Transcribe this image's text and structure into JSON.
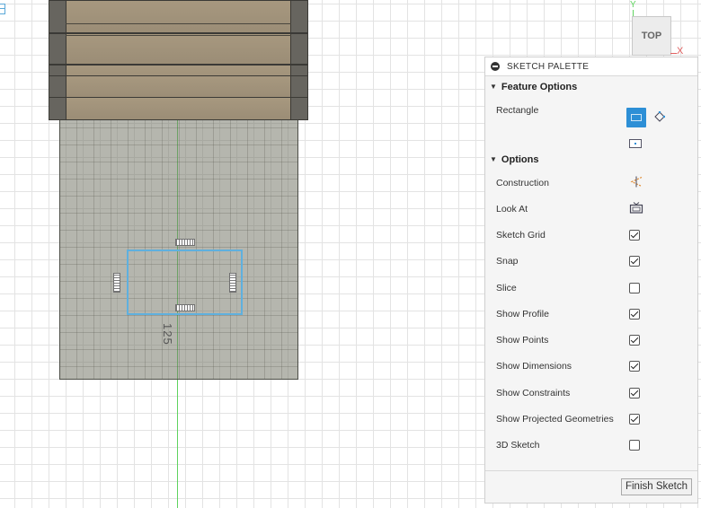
{
  "viewcube": {
    "face_label": "TOP",
    "y_axis_label": "Y",
    "x_axis_label": "X"
  },
  "sketch": {
    "dimension_value": "125"
  },
  "palette": {
    "title": "SKETCH PALETTE",
    "feature_options_label": "Feature Options",
    "rectangle_label": "Rectangle",
    "options_label": "Options",
    "options": [
      {
        "label": "Construction",
        "control": "construction-icon"
      },
      {
        "label": "Look At",
        "control": "look-at-icon"
      },
      {
        "label": "Sketch Grid",
        "control": "checkbox",
        "checked": true
      },
      {
        "label": "Snap",
        "control": "checkbox",
        "checked": true
      },
      {
        "label": "Slice",
        "control": "checkbox",
        "checked": false
      },
      {
        "label": "Show Profile",
        "control": "checkbox",
        "checked": true
      },
      {
        "label": "Show Points",
        "control": "checkbox",
        "checked": true
      },
      {
        "label": "Show Dimensions",
        "control": "checkbox",
        "checked": true
      },
      {
        "label": "Show Constraints",
        "control": "checkbox",
        "checked": true
      },
      {
        "label": "Show Projected Geometries",
        "control": "checkbox",
        "checked": true
      },
      {
        "label": "3D Sketch",
        "control": "checkbox",
        "checked": false
      }
    ],
    "finish_label": "Finish Sketch"
  },
  "colors": {
    "accent": "#2d8fd6",
    "sketch_line": "#5fb0de",
    "y_axis": "#5fd35f",
    "x_axis": "#e06060"
  }
}
